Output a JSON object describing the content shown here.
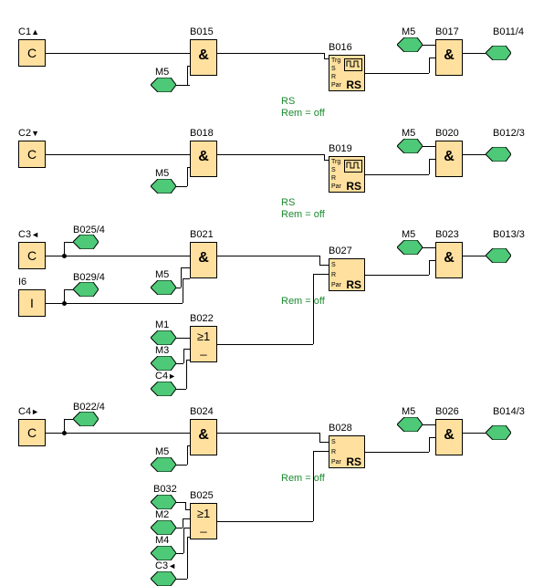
{
  "inputs": {
    "C1": "C",
    "C2": "C",
    "C3": "C",
    "C4": "C",
    "I6": "I"
  },
  "input_labels": {
    "C1": "C1",
    "C2": "C2",
    "C3": "C3",
    "C4": "C4",
    "I6": "I6"
  },
  "dir_icons": {
    "C1": "▲",
    "C2": "▼",
    "C3": "◄",
    "C4": "►"
  },
  "blocks": {
    "B015": {
      "label": "B015",
      "sym": "&"
    },
    "B016": {
      "label": "B016",
      "sym": "RS"
    },
    "B017": {
      "label": "B017",
      "sym": "&"
    },
    "B018": {
      "label": "B018",
      "sym": "&"
    },
    "B019": {
      "label": "B019",
      "sym": "RS"
    },
    "B020": {
      "label": "B020",
      "sym": "&"
    },
    "B021": {
      "label": "B021",
      "sym": "&"
    },
    "B022": {
      "label": "B022",
      "sym": "≥1"
    },
    "B023": {
      "label": "B023",
      "sym": "&"
    },
    "B024": {
      "label": "B024",
      "sym": "&"
    },
    "B025": {
      "label": "B025",
      "sym": "≥1"
    },
    "B026": {
      "label": "B026",
      "sym": "&"
    },
    "B027": {
      "label": "B027",
      "sym": "RS"
    },
    "B028": {
      "label": "B028",
      "sym": "RS"
    }
  },
  "outputs": {
    "B011": "B011/4",
    "B012": "B012/3",
    "B013": "B013/3",
    "B014": "B014/3"
  },
  "mem_flags": {
    "M1": "M1",
    "M2": "M2",
    "M3": "M3",
    "M4": "M4",
    "M5": "M5"
  },
  "conn_flags": {
    "B025_4": "B025/4",
    "B029_4": "B029/4",
    "B022_4": "B022/4",
    "B032": "B032"
  },
  "cursor_flags": {
    "C3i": "C3",
    "C4i": "C4"
  },
  "cursor_flag_icons": {
    "C3i": "◄",
    "C4i": "►"
  },
  "rs_pins": {
    "Trg": "Trg",
    "S": "S",
    "R": "R",
    "Par": "Par"
  },
  "params": {
    "B016": "RS\nRem = off",
    "B019": "RS\nRem = off",
    "B027": "Rem = off",
    "B028": "Rem = off"
  },
  "or_underline": "_"
}
